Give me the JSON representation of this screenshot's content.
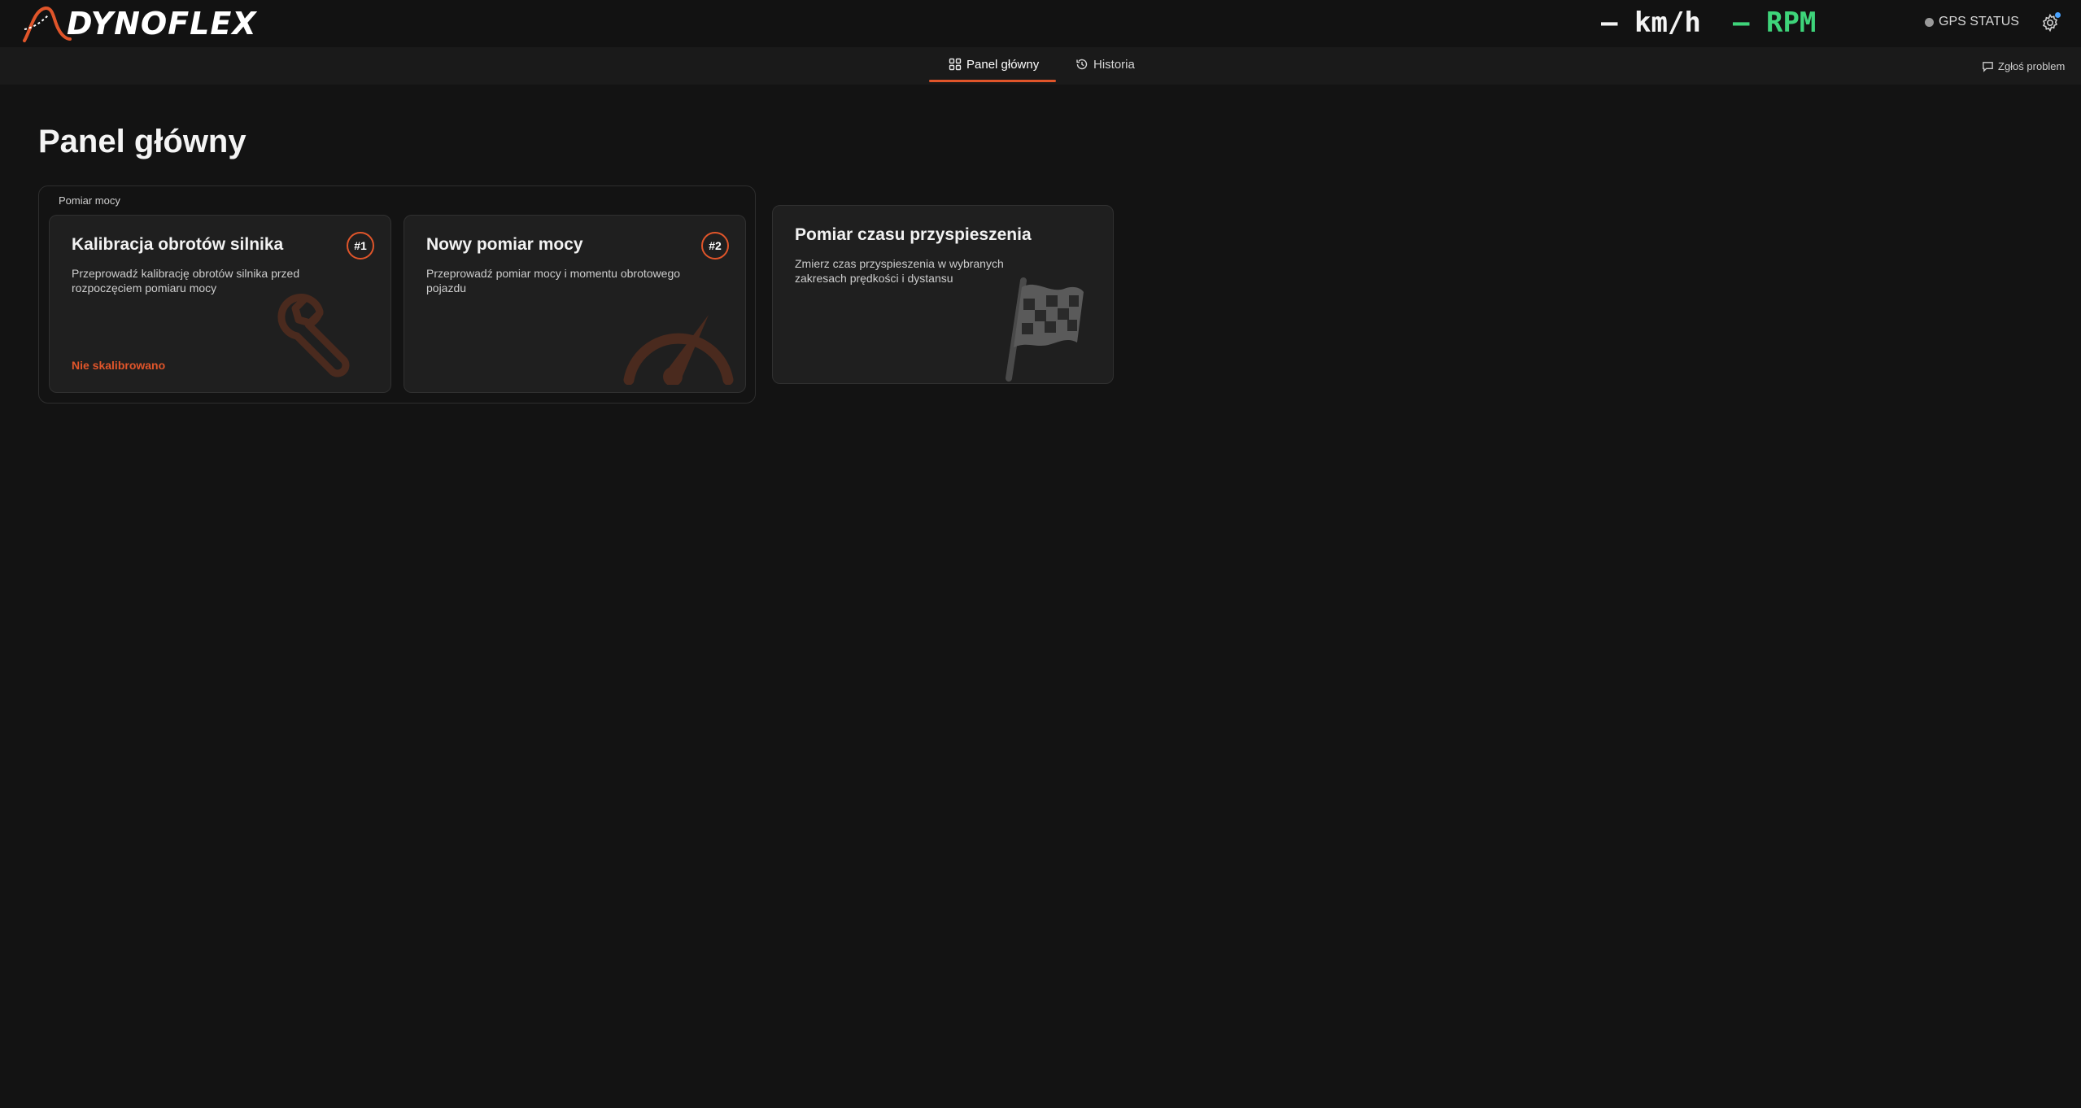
{
  "header": {
    "logo_text": "DYNOFLEX",
    "speed_value": "–",
    "speed_unit": "km/h",
    "rpm_value": "–",
    "rpm_unit": "RPM",
    "gps_label": "GPS STATUS"
  },
  "nav": {
    "tabs": [
      {
        "label": "Panel główny",
        "icon": "grid-icon",
        "active": true
      },
      {
        "label": "Historia",
        "icon": "history-icon",
        "active": false
      }
    ],
    "report_label": "Zgłoś problem"
  },
  "main": {
    "title": "Panel główny",
    "group": {
      "label": "Pomiar mocy",
      "cards": [
        {
          "title": "Kalibracja obrotów silnika",
          "description": "Przeprowadź kalibrację obrotów silnika przed rozpoczęciem pomiaru mocy",
          "badge": "#1",
          "status": "Nie skalibrowano",
          "icon": "wrench-icon"
        },
        {
          "title": "Nowy pomiar mocy",
          "description": "Przeprowadź pomiar mocy i momentu obrotowego pojazdu",
          "badge": "#2",
          "icon": "gauge-icon"
        }
      ]
    },
    "standalone_card": {
      "title": "Pomiar czasu przyspieszenia",
      "description": "Zmierz czas przyspieszenia w wybranych zakresach prędkości i dystansu",
      "icon": "checkered-flag-icon"
    }
  },
  "colors": {
    "accent": "#e0552a",
    "rpm": "#3ed47a",
    "background": "#131313",
    "card": "#1f1f1f"
  }
}
